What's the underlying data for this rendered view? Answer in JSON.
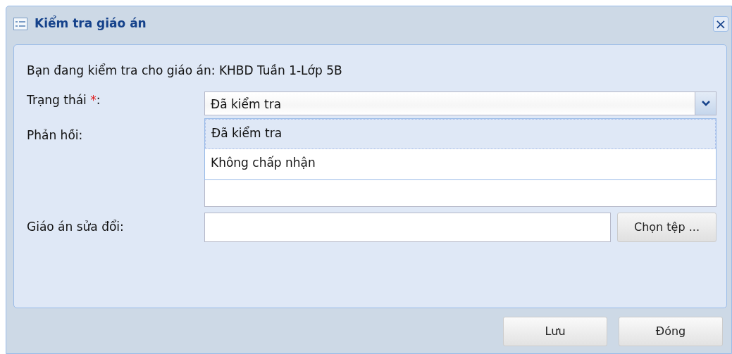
{
  "window": {
    "title": "Kiểm tra giáo án",
    "close": "×"
  },
  "intro": "Bạn đang kiểm tra cho giáo án: KHBD Tuần 1-Lớp 5B",
  "status": {
    "label": "Trạng thái ",
    "required": "*",
    "colon": ":",
    "value": "Đã kiểm tra",
    "expanded": true,
    "options": [
      {
        "label": "Đã kiểm tra",
        "selected": true
      },
      {
        "label": "Không chấp nhận",
        "selected": false
      }
    ]
  },
  "feedback": {
    "label": "Phản hồi:"
  },
  "revised_plan": {
    "label": "Giáo án sửa đổi:",
    "button": "Chọn tệp ..."
  },
  "buttons": [
    "Lưu",
    "Đóng"
  ]
}
